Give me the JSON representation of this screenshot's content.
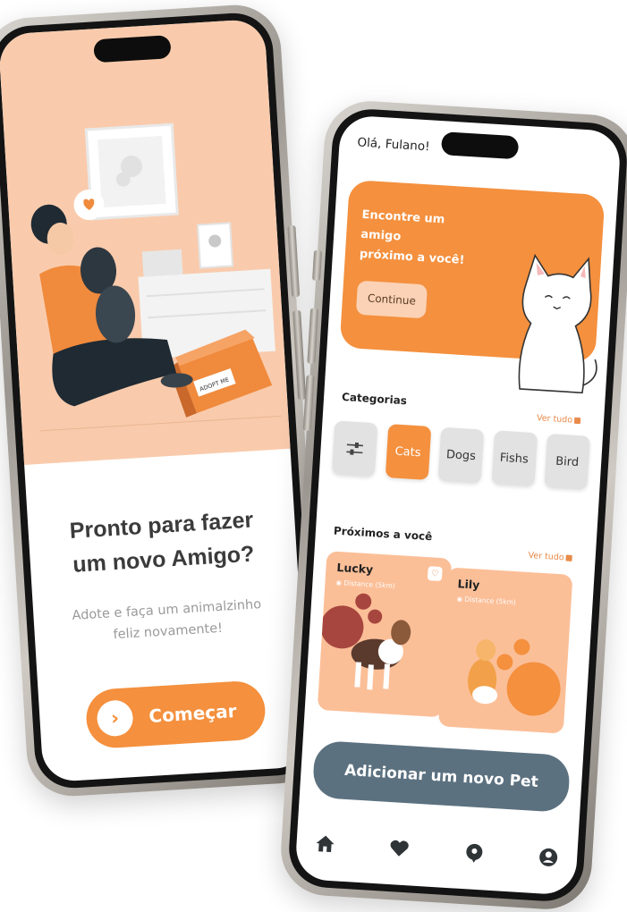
{
  "onboarding": {
    "title_line1": "Pronto para fazer",
    "title_line2": "um novo Amigo?",
    "subtitle_line1": "Adote e faça um animalzinho",
    "subtitle_line2": "feliz novamente!",
    "start_label": "Começar",
    "box_label": "ADOPT ME",
    "colors": {
      "hero_bg": "#f9cbac",
      "accent": "#f4903e"
    }
  },
  "home": {
    "greeting": "Olá, Fulano!",
    "promo": {
      "line1": "Encontre um amigo",
      "line2": "próximo a você!",
      "button": "Continue"
    },
    "categories": {
      "title": "Categorias",
      "see_all": "Ver tudo",
      "items": [
        {
          "label": "",
          "icon": "filter-sliders-icon"
        },
        {
          "label": "Cats",
          "active": true
        },
        {
          "label": "Dogs"
        },
        {
          "label": "Fishs"
        },
        {
          "label": "Bird"
        }
      ]
    },
    "nearby": {
      "title": "Próximos a você",
      "see_all": "Ver tudo",
      "items": [
        {
          "name": "Lucky",
          "distance": "Distance (5km)",
          "favorite_icon": "heart-icon"
        },
        {
          "name": "Lily",
          "distance": "Distance (5km)"
        }
      ]
    },
    "add_pet_label": "Adicionar um novo Pet",
    "tabbar": [
      "home-icon",
      "heart-icon",
      "map-pin-icon",
      "profile-icon"
    ],
    "colors": {
      "accent": "#f4903e",
      "add_button": "#5c7180",
      "chip_bg": "#e2e2e2"
    }
  }
}
